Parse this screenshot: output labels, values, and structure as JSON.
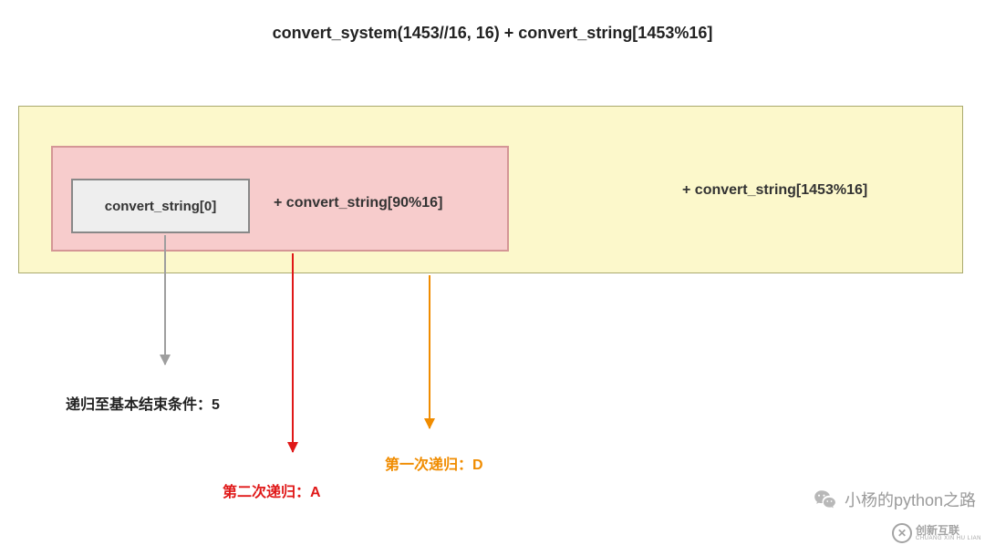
{
  "title": "convert_system(1453//16, 16) + convert_string[1453%16]",
  "boxes": {
    "base": "convert_string[0]",
    "inner_right": "+ convert_string[90%16]",
    "outer_right": "+ convert_string[1453%16]"
  },
  "labels": {
    "grey": "递归至基本结束条件：5",
    "red": "第二次递归：A",
    "orange": "第一次递归：D"
  },
  "badge": {
    "wechat_text": "小杨的python之路"
  },
  "corner": {
    "cn": "创新互联",
    "en": "CHUANG XIN HU LIAN"
  },
  "colors": {
    "grey": "#9e9e9e",
    "red": "#e01818",
    "orange": "#f08c00",
    "outer_fill": "#fcf8cb",
    "inner_fill": "#f7cccc",
    "base_fill": "#eeeeee"
  }
}
